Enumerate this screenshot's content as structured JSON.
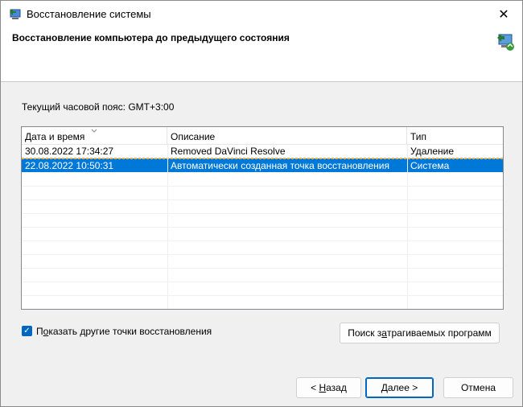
{
  "window": {
    "title": "Восстановление системы",
    "close_glyph": "✕",
    "app_icon": "system-restore-icon"
  },
  "header": {
    "title": "Восстановление компьютера до предыдущего состояния",
    "icon": "system-restore-icon"
  },
  "timezone": {
    "label": "Текущий часовой пояс: GMT+3:00"
  },
  "table": {
    "columns": [
      "Дата и время",
      "Описание",
      "Тип"
    ],
    "rows": [
      {
        "date": "30.08.2022 17:34:27",
        "description": "Removed DaVinci Resolve",
        "type": "Удаление",
        "selected": false
      },
      {
        "date": "22.08.2022 10:50:31",
        "description": "Автоматически созданная точка восстановления",
        "type": "Система",
        "selected": true
      }
    ]
  },
  "show_more": {
    "label_prefix": "П",
    "label_accel": "о",
    "label_suffix": "казать другие точки восстановления",
    "checked": true,
    "check_glyph": "✓"
  },
  "buttons": {
    "scan_prefix": "Поиск з",
    "scan_accel": "а",
    "scan_suffix": "трагиваемых программ",
    "back_prefix": "< ",
    "back_accel": "Н",
    "back_suffix": "азад",
    "next_label": "Далее >",
    "cancel_label": "Отмена"
  },
  "colors": {
    "selection": "#0078d7",
    "accent": "#0067c0"
  }
}
